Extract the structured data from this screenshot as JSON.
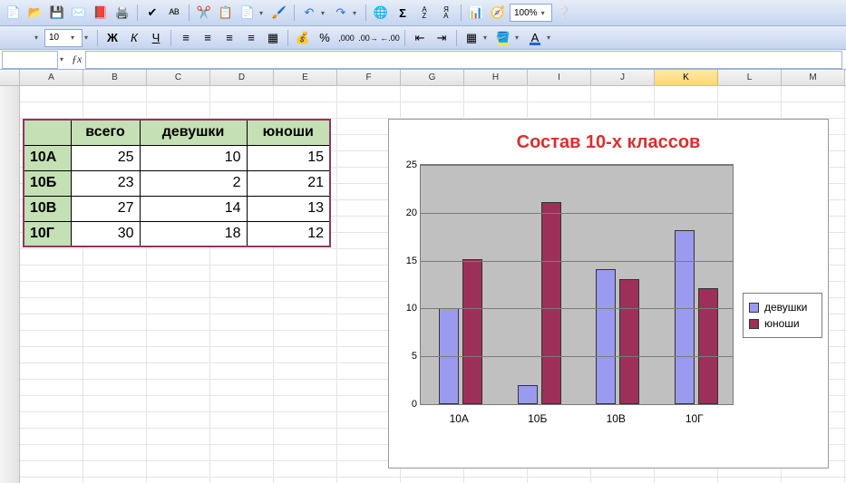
{
  "toolbar": {
    "zoom": "100%",
    "font_size": "10"
  },
  "columns": [
    "A",
    "B",
    "C",
    "D",
    "E",
    "F",
    "G",
    "H",
    "I",
    "J",
    "K",
    "L",
    "M"
  ],
  "selected_col": "K",
  "data_table": {
    "headers": [
      "",
      "всего",
      "девушки",
      "юноши"
    ],
    "rows": [
      {
        "label": "10А",
        "values": [
          25,
          10,
          15
        ]
      },
      {
        "label": "10Б",
        "values": [
          23,
          2,
          21
        ]
      },
      {
        "label": "10В",
        "values": [
          27,
          14,
          13
        ]
      },
      {
        "label": "10Г",
        "values": [
          30,
          18,
          12
        ]
      }
    ]
  },
  "chart_data": {
    "type": "bar",
    "title": "Состав 10-х классов",
    "categories": [
      "10А",
      "10Б",
      "10В",
      "10Г"
    ],
    "series": [
      {
        "name": "девушки",
        "values": [
          10,
          2,
          14,
          18
        ]
      },
      {
        "name": "юноши",
        "values": [
          15,
          21,
          13,
          12
        ]
      }
    ],
    "yticks": [
      0,
      5,
      10,
      15,
      20,
      25
    ],
    "ylim": [
      0,
      25
    ],
    "xlabel": "",
    "ylabel": "",
    "legend_position": "right"
  }
}
